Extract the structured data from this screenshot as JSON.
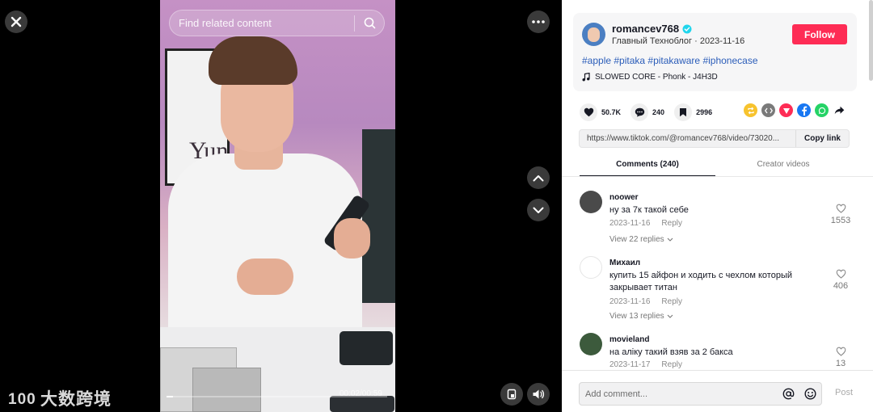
{
  "search": {
    "placeholder": "Find related content"
  },
  "video": {
    "background_text": "Yun",
    "time": "00:02/00:59",
    "progress": 0.03
  },
  "watermark": {
    "text": "大数跨境",
    "logo_text": "100"
  },
  "author": {
    "username": "romancev768",
    "verified": true,
    "subtitle": "Главный Техноблог · 2023-11-16",
    "follow_label": "Follow"
  },
  "post": {
    "hashtags": "#apple #pitaka #pitakaware #iphonecase",
    "music": "SLOWED CORE - Phonk - J4H3D"
  },
  "stats": {
    "likes": "50.7K",
    "comments": "240",
    "saves": "2996"
  },
  "share": {
    "icons": [
      "repost-icon",
      "embed-icon",
      "send-icon",
      "facebook-icon",
      "whatsapp-icon",
      "share-arrow-icon"
    ],
    "colors": [
      "#f7c32e",
      "#7a7a7a",
      "#fe2c55",
      "#1877f2",
      "#25d366",
      "#161823"
    ]
  },
  "link": {
    "url": "https://www.tiktok.com/@romancev768/video/73020...",
    "copy_label": "Copy link"
  },
  "tabs": {
    "comments": "Comments (240)",
    "creator": "Creator videos"
  },
  "comments": [
    {
      "user": "noower",
      "text": "ну за 7к такой себе",
      "date": "2023-11-16",
      "reply": "Reply",
      "replies": "View 22 replies",
      "likes": "1553",
      "avatar_color": "#4a4a4a"
    },
    {
      "user": "Михаил",
      "text": "купить 15 айфон и ходить с чехлом который закрывает титан",
      "date": "2023-11-16",
      "reply": "Reply",
      "replies": "View 13 replies",
      "likes": "406",
      "avatar_color": "#ffffff"
    },
    {
      "user": "movieland",
      "text": "на аліку такий взяв за 2 бакса",
      "date": "2023-11-17",
      "reply": "Reply",
      "replies": "",
      "likes": "13",
      "avatar_color": "#3c5a3c"
    }
  ],
  "comment_box": {
    "placeholder": "Add comment...",
    "post_label": "Post"
  }
}
